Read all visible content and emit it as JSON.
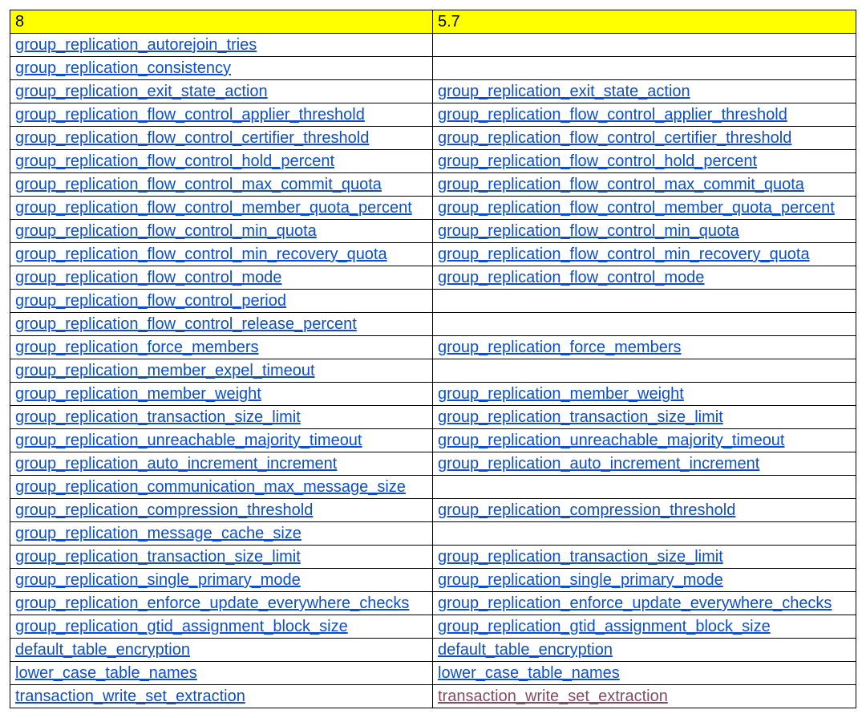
{
  "headers": [
    "8",
    "5.7"
  ],
  "rows": [
    {
      "left": "group_replication_autorejoin_tries",
      "right": ""
    },
    {
      "left": "group_replication_consistency",
      "right": ""
    },
    {
      "left": "group_replication_exit_state_action",
      "right": "group_replication_exit_state_action"
    },
    {
      "left": "group_replication_flow_control_applier_threshold",
      "right": "group_replication_flow_control_applier_threshold"
    },
    {
      "left": "group_replication_flow_control_certifier_threshold",
      "right": "group_replication_flow_control_certifier_threshold"
    },
    {
      "left": "group_replication_flow_control_hold_percent",
      "right": "group_replication_flow_control_hold_percent"
    },
    {
      "left": "group_replication_flow_control_max_commit_quota",
      "right": "group_replication_flow_control_max_commit_quota"
    },
    {
      "left": "group_replication_flow_control_member_quota_percent",
      "right": "group_replication_flow_control_member_quota_percent"
    },
    {
      "left": "group_replication_flow_control_min_quota",
      "right": "group_replication_flow_control_min_quota"
    },
    {
      "left": "group_replication_flow_control_min_recovery_quota",
      "right": "group_replication_flow_control_min_recovery_quota"
    },
    {
      "left": "group_replication_flow_control_mode",
      "right": "group_replication_flow_control_mode"
    },
    {
      "left": "group_replication_flow_control_period",
      "right": ""
    },
    {
      "left": "group_replication_flow_control_release_percent",
      "right": ""
    },
    {
      "left": "group_replication_force_members",
      "right": "group_replication_force_members"
    },
    {
      "left": "group_replication_member_expel_timeout",
      "right": ""
    },
    {
      "left": "group_replication_member_weight",
      "right": "group_replication_member_weight"
    },
    {
      "left": "group_replication_transaction_size_limit",
      "right": "group_replication_transaction_size_limit"
    },
    {
      "left": "group_replication_unreachable_majority_timeout",
      "right": "group_replication_unreachable_majority_timeout"
    },
    {
      "left": "group_replication_auto_increment_increment",
      "right": "group_replication_auto_increment_increment"
    },
    {
      "left": "group_replication_communication_max_message_size",
      "right": ""
    },
    {
      "left": "group_replication_compression_threshold",
      "right": "group_replication_compression_threshold"
    },
    {
      "left": "group_replication_message_cache_size",
      "right": ""
    },
    {
      "left": "group_replication_transaction_size_limit",
      "right": "group_replication_transaction_size_limit"
    },
    {
      "left": "group_replication_single_primary_mode",
      "right": "group_replication_single_primary_mode"
    },
    {
      "left": "group_replication_enforce_update_everywhere_checks",
      "right": "group_replication_enforce_update_everywhere_checks"
    },
    {
      "left": "group_replication_gtid_assignment_block_size",
      "right": "group_replication_gtid_assignment_block_size"
    },
    {
      "left": "default_table_encryption",
      "right": "default_table_encryption"
    },
    {
      "left": "lower_case_table_names",
      "right": "lower_case_table_names"
    },
    {
      "left": "transaction_write_set_extraction",
      "right": "transaction_write_set_extraction",
      "right_alt": true
    }
  ]
}
